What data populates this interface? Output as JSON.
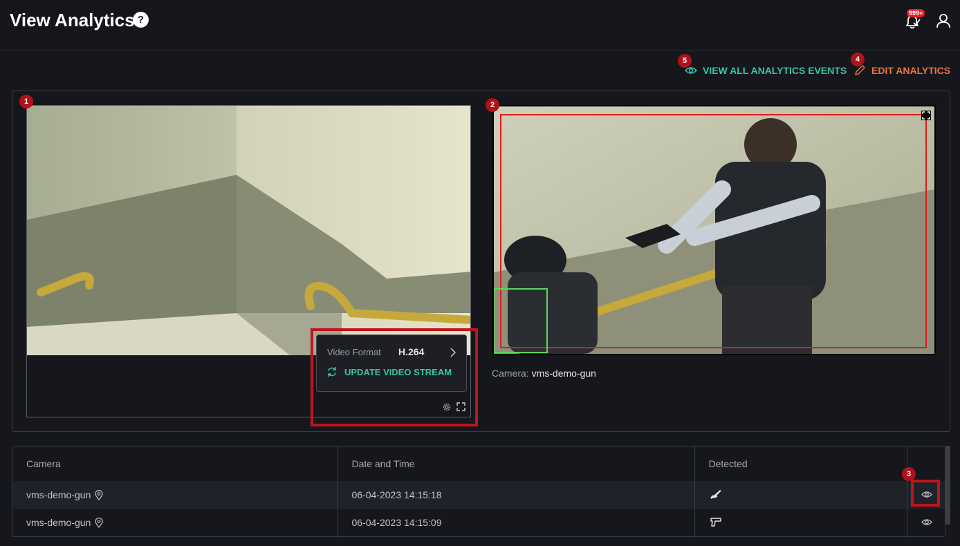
{
  "header": {
    "title": "View Analytics",
    "help_label": "?",
    "notification_count": "999+"
  },
  "actions": {
    "view_all_label": "VIEW ALL ANALYTICS EVENTS",
    "edit_label": "EDIT ANALYTICS"
  },
  "callouts": [
    "1",
    "2",
    "3",
    "4",
    "5"
  ],
  "video_settings": {
    "format_label": "Video Format",
    "format_value": "H.264",
    "update_label": "UPDATE VIDEO STREAM"
  },
  "analytics_view": {
    "camera_label": "Camera:",
    "camera_name": "vms-demo-gun"
  },
  "table": {
    "columns": [
      "Camera",
      "Date and Time",
      "Detected",
      ""
    ],
    "rows": [
      {
        "camera": "vms-demo-gun",
        "datetime": "06-04-2023 14:15:18",
        "detected_icon": "rifle-icon"
      },
      {
        "camera": "vms-demo-gun",
        "datetime": "06-04-2023 14:15:09",
        "detected_icon": "pistol-icon"
      }
    ]
  },
  "colors": {
    "accent_teal": "#39c4a7",
    "accent_orange": "#e8763a",
    "callout_red": "#b0121a",
    "badge_red": "#e32027"
  }
}
